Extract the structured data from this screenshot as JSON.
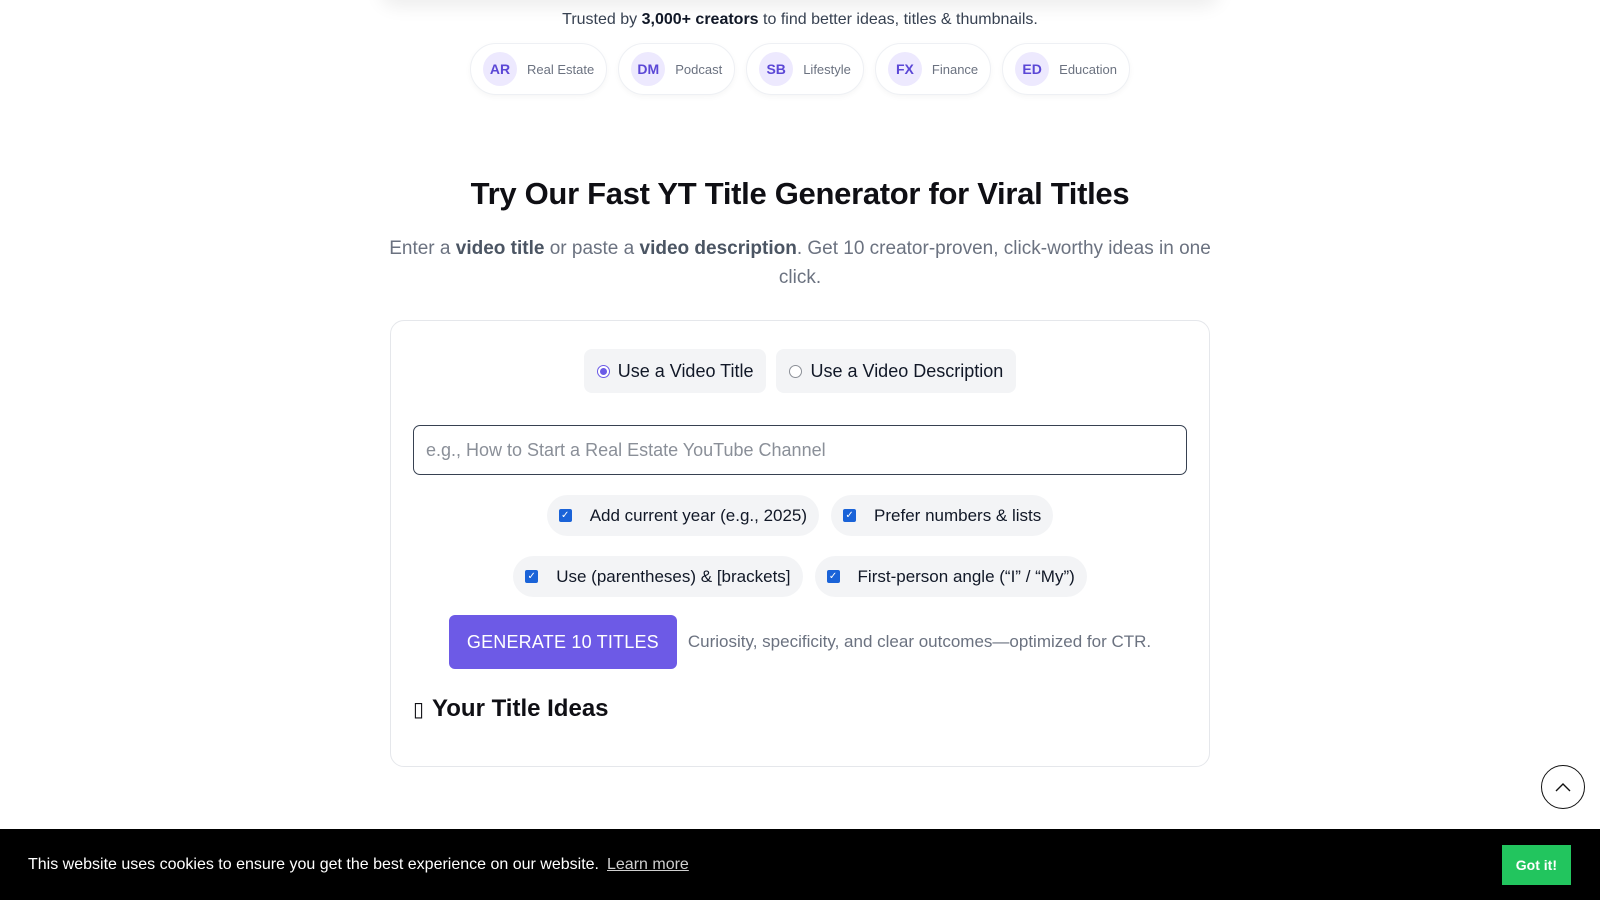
{
  "trusted": {
    "prefix": "Trusted by",
    "highlight": "3,000+ creators",
    "suffix": "to find better ideas, titles & thumbnails."
  },
  "niches": [
    {
      "initials": "AR",
      "label": "Real Estate"
    },
    {
      "initials": "DM",
      "label": "Podcast"
    },
    {
      "initials": "SB",
      "label": "Lifestyle"
    },
    {
      "initials": "FX",
      "label": "Finance"
    },
    {
      "initials": "ED",
      "label": "Education"
    }
  ],
  "hero": {
    "title": "Try Our Fast YT Title Generator for Viral Titles",
    "sub_1": "Enter a",
    "sub_b1": "video title",
    "sub_2": "or paste a",
    "sub_b2": "video description",
    "sub_3": ". Get 10 creator-proven, click-worthy ideas in one click."
  },
  "form": {
    "mode_title": "Use a Video Title",
    "mode_description": "Use a Video Description",
    "selected_mode": "title",
    "input_placeholder": "e.g., How to Start a Real Estate YouTube Channel",
    "input_value": "",
    "options": [
      {
        "label": "Add current year (e.g., 2025)",
        "checked": true
      },
      {
        "label": "Prefer numbers & lists",
        "checked": true
      },
      {
        "label": "Use (parentheses) & [brackets]",
        "checked": true
      },
      {
        "label": "First-person angle (“I” / “My”)",
        "checked": true
      }
    ],
    "generate_label": "GENERATE 10 TITLES",
    "generate_note": "Curiosity, specificity, and clear outcomes—optimized for CTR."
  },
  "results": {
    "heading": "Your Title Ideas",
    "icon": "missing-glyph-icon"
  },
  "cookie": {
    "message": "This website uses cookies to ensure you get the best experience on our website.",
    "learn_more": "Learn more",
    "accept": "Got it!"
  },
  "colors": {
    "accent": "#6d5ae6",
    "checkbox": "#1a63d8",
    "cookie_bg": "#000000",
    "cookie_button": "#22c55e"
  }
}
